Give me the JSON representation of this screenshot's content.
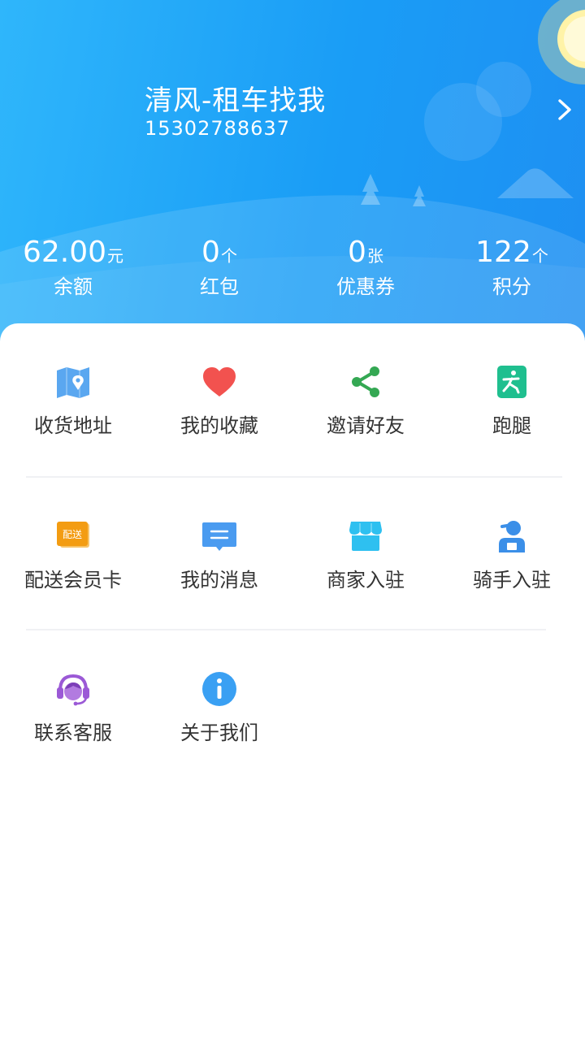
{
  "profile": {
    "name": "清风-租车找我",
    "phone": "15302788637"
  },
  "stats": [
    {
      "value": "62.00",
      "unit": "元",
      "label": "余额"
    },
    {
      "value": "0",
      "unit": "个",
      "label": "红包"
    },
    {
      "value": "0",
      "unit": "张",
      "label": "优惠券"
    },
    {
      "value": "122",
      "unit": "个",
      "label": "积分"
    }
  ],
  "menu": {
    "row1": [
      {
        "label": "收货地址",
        "icon": "map-icon"
      },
      {
        "label": "我的收藏",
        "icon": "heart-icon"
      },
      {
        "label": "邀请好友",
        "icon": "share-icon"
      },
      {
        "label": "跑腿",
        "icon": "runner-icon"
      }
    ],
    "row2": [
      {
        "label": "配送会员卡",
        "icon": "member-card-icon",
        "badge": "配送"
      },
      {
        "label": "我的消息",
        "icon": "message-icon"
      },
      {
        "label": "商家入驻",
        "icon": "store-icon"
      },
      {
        "label": "骑手入驻",
        "icon": "rider-icon"
      }
    ],
    "row3": [
      {
        "label": "联系客服",
        "icon": "headset-icon"
      },
      {
        "label": "关于我们",
        "icon": "info-icon"
      }
    ]
  },
  "colors": {
    "header_start": "#2fb6fb",
    "header_end": "#1e8ff2",
    "map": "#5aa7f0",
    "heart": "#f2524f",
    "share": "#34a853",
    "runner": "#1fbf8f",
    "card": "#f39c12",
    "message": "#4a9bf0",
    "store": "#2ec0f0",
    "rider": "#3b8fe8",
    "headset": "#9b59d6",
    "info": "#3aa0f3"
  }
}
